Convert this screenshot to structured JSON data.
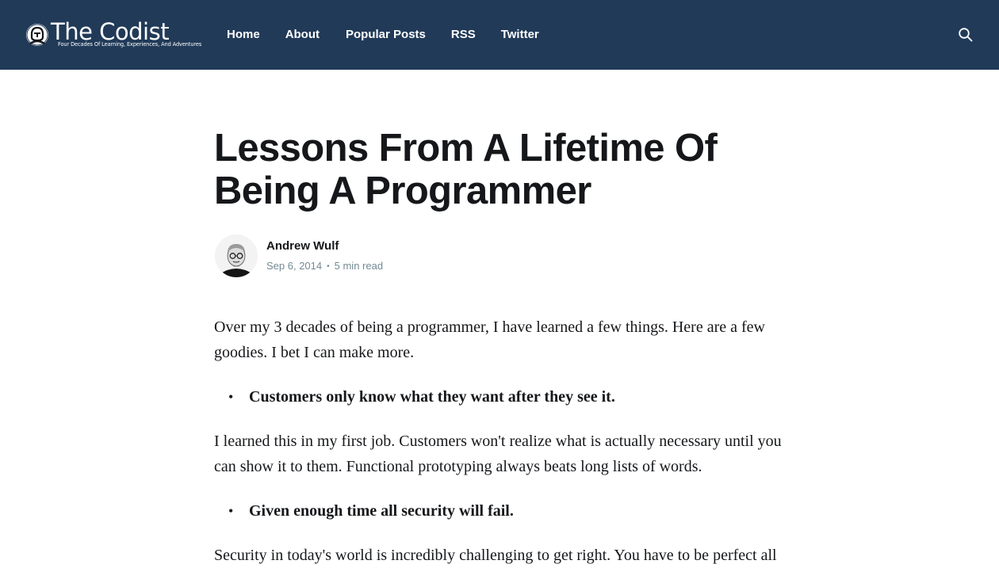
{
  "header": {
    "logo": {
      "title": "The Codist",
      "tagline": "Four Decades Of Learning, Experiences, And Adventures",
      "icon": "face-badge-icon"
    },
    "nav": [
      {
        "label": "Home"
      },
      {
        "label": "About"
      },
      {
        "label": "Popular Posts"
      },
      {
        "label": "RSS"
      },
      {
        "label": "Twitter"
      }
    ],
    "search_icon": "search-icon",
    "background_color": "#213a58"
  },
  "article": {
    "title": "Lessons From A Lifetime Of Being A Programmer",
    "author": {
      "name": "Andrew Wulf",
      "avatar": "author-avatar"
    },
    "date": "Sep 6, 2014",
    "separator": "•",
    "reading_time": "5 min read",
    "body": [
      {
        "type": "p",
        "text": "Over my 3 decades of being a programmer, I have learned a few things. Here are a few goodies. I bet I can make more."
      },
      {
        "type": "li",
        "text": "Customers only know what they want after they see it."
      },
      {
        "type": "p",
        "text": "I learned this in my first job. Customers won't realize what is actually necessary until you can show it to them. Functional prototyping always beats long lists of words."
      },
      {
        "type": "li",
        "text": "Given enough time all security will fail."
      },
      {
        "type": "p",
        "text": "Security in today's world is incredibly challenging to get right. You have to be perfect all"
      }
    ],
    "bullet_glyph": "•"
  }
}
